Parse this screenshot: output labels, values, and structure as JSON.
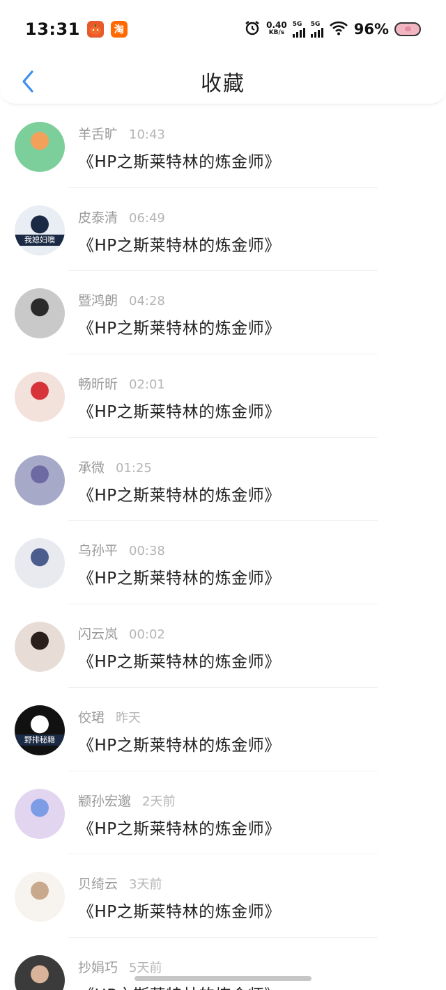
{
  "status_bar": {
    "time": "13:31",
    "app_badge_1_icon": "pumpkin-app-icon",
    "app_badge_2": "淘",
    "alarm_icon": "alarm-icon",
    "speed_value": "0.40",
    "speed_unit": "KB/s",
    "sim1_label": "5G",
    "sim2_label": "5G",
    "wifi_icon": "wifi-icon",
    "battery": "96%",
    "battery_icon": "pig-battery-icon"
  },
  "nav": {
    "back_icon": "chevron-left-icon",
    "title": "收藏"
  },
  "colors": {
    "accent": "#3d8ff0",
    "text_primary": "#222222",
    "text_secondary": "#9a9a9a"
  },
  "items": [
    {
      "name": "羊舌旷",
      "time": "10:43",
      "title": "《HP之斯莱特林的炼金师》",
      "avatar_color": "#7ccf9a",
      "avatar_accent": "#f3a15a"
    },
    {
      "name": "皮泰清",
      "time": "06:49",
      "title": "《HP之斯莱特林的炼金师》",
      "avatar_color": "#e9eef5",
      "avatar_accent": "#1b2a44",
      "avatar_caption": "我媳妇噢"
    },
    {
      "name": "暨鸿朗",
      "time": "04:28",
      "title": "《HP之斯莱特林的炼金师》",
      "avatar_color": "#c9c9c9",
      "avatar_accent": "#2b2b2b"
    },
    {
      "name": "畅昕昕",
      "time": "02:01",
      "title": "《HP之斯莱特林的炼金师》",
      "avatar_color": "#f3e1dc",
      "avatar_accent": "#d6333b"
    },
    {
      "name": "承微",
      "time": "01:25",
      "title": "《HP之斯莱特林的炼金师》",
      "avatar_color": "#a7a9c9",
      "avatar_accent": "#6d6aa3"
    },
    {
      "name": "乌孙平",
      "time": "00:38",
      "title": "《HP之斯莱特林的炼金师》",
      "avatar_color": "#e8eaf0",
      "avatar_accent": "#4b5d8c"
    },
    {
      "name": "闪云岚",
      "time": "00:02",
      "title": "《HP之斯莱特林的炼金师》",
      "avatar_color": "#e8ddd6",
      "avatar_accent": "#2a1f1b"
    },
    {
      "name": "佼珺",
      "time": "昨天",
      "title": "《HP之斯莱特林的炼金师》",
      "avatar_color": "#111111",
      "avatar_accent": "#ffffff",
      "avatar_caption": "野排秘籍"
    },
    {
      "name": "颛孙宏邈",
      "time": "2天前",
      "title": "《HP之斯莱特林的炼金师》",
      "avatar_color": "#e2d5f0",
      "avatar_accent": "#7d9ce6"
    },
    {
      "name": "贝绮云",
      "time": "3天前",
      "title": "《HP之斯莱特林的炼金师》",
      "avatar_color": "#f7f3ee",
      "avatar_accent": "#c9a98d"
    },
    {
      "name": "抄娟巧",
      "time": "5天前",
      "title": "《HP之斯莱特林的炼金师》",
      "avatar_color": "#3b3b3b",
      "avatar_accent": "#d9b49a"
    }
  ]
}
